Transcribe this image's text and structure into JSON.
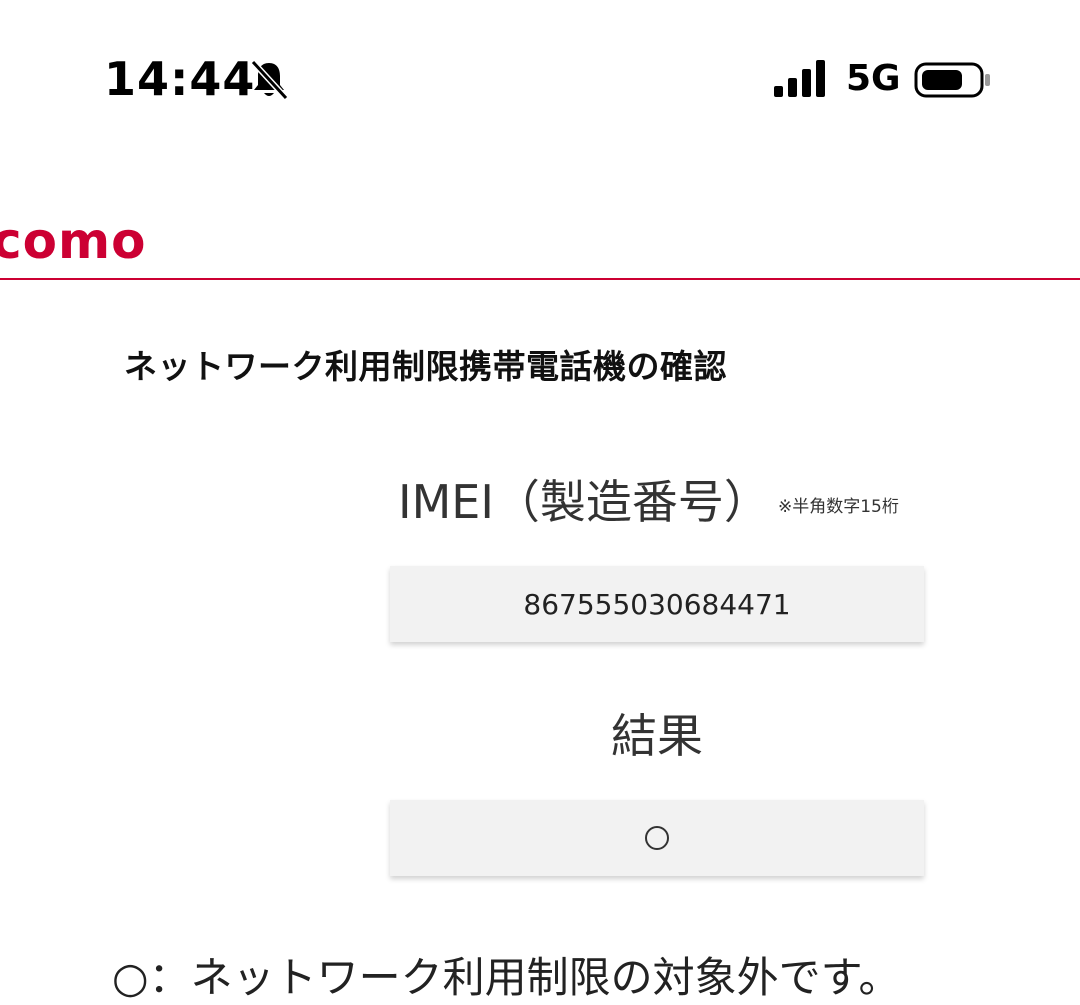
{
  "status_bar": {
    "time": "14:44",
    "network": "5G"
  },
  "header": {
    "logo_text": "como",
    "brand_color": "#cc0033"
  },
  "page": {
    "title": "ネットワーク利用制限携帯電話機の確認",
    "imei_label": "IMEI（製造番号）",
    "imei_note": "※半角数字15桁",
    "imei_value": "867555030684471",
    "result_label": "結果",
    "result_value": "○",
    "bottom_message": "○：ネットワーク利用制限の対象外です。"
  },
  "icons": {
    "bell": "bell-muted-icon",
    "signal": "signal-icon",
    "battery": "battery-icon"
  }
}
